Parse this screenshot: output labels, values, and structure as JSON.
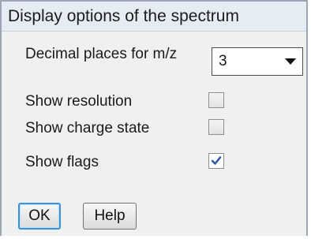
{
  "dialog": {
    "title": "Display options of the spectrum"
  },
  "options": {
    "decimal_places_label": "Decimal places for m/z",
    "decimal_places_value": "3",
    "show_resolution_label": "Show resolution",
    "show_resolution_checked": false,
    "show_charge_state_label": "Show charge state",
    "show_charge_state_checked": false,
    "show_flags_label": "Show flags",
    "show_flags_checked": true
  },
  "buttons": {
    "ok_label": "OK",
    "help_label": "Help"
  },
  "icons": {
    "dropdown": "chevron-down-icon",
    "check": "check-icon"
  },
  "colors": {
    "title_bar": "#e6ecf4",
    "dialog_bg": "#f0f0f0",
    "focus_border": "#3c8fd8",
    "check_color": "#2d55a7"
  }
}
